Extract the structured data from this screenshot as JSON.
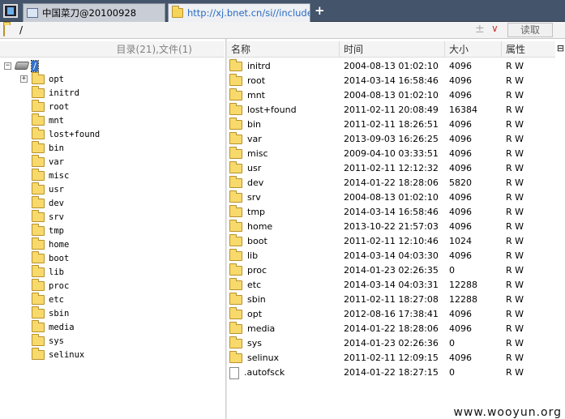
{
  "tabs": [
    {
      "label": "中国菜刀@20100928",
      "active": false,
      "icon": "page-icon"
    },
    {
      "label": "http://xj.bnet.cn/si//include/...",
      "active": true,
      "icon": "folder-icon"
    }
  ],
  "tab_add": "+",
  "address": {
    "path": "/",
    "separator": "±",
    "dropdown": "∨",
    "read_button": "读取"
  },
  "left_header": "目录(21),文件(1)",
  "tree": {
    "root": {
      "expand": "−",
      "label": "/"
    },
    "items": [
      {
        "label": "opt",
        "expand": "+"
      },
      {
        "label": "initrd"
      },
      {
        "label": "root"
      },
      {
        "label": "mnt"
      },
      {
        "label": "lost+found"
      },
      {
        "label": "bin"
      },
      {
        "label": "var"
      },
      {
        "label": "misc"
      },
      {
        "label": "usr"
      },
      {
        "label": "dev"
      },
      {
        "label": "srv"
      },
      {
        "label": "tmp"
      },
      {
        "label": "home"
      },
      {
        "label": "boot"
      },
      {
        "label": "lib"
      },
      {
        "label": "proc"
      },
      {
        "label": "etc"
      },
      {
        "label": "sbin"
      },
      {
        "label": "media"
      },
      {
        "label": "sys"
      },
      {
        "label": "selinux"
      }
    ]
  },
  "columns": {
    "name": "名称",
    "time": "时间",
    "size": "大小",
    "perm": "属性"
  },
  "scroll_glyph": "⊟",
  "files": [
    {
      "name": "initrd",
      "time": "2004-08-13 01:02:10",
      "size": "4096",
      "perm": "R W",
      "type": "dir"
    },
    {
      "name": "root",
      "time": "2014-03-14 16:58:46",
      "size": "4096",
      "perm": "R W",
      "type": "dir"
    },
    {
      "name": "mnt",
      "time": "2004-08-13 01:02:10",
      "size": "4096",
      "perm": "R W",
      "type": "dir"
    },
    {
      "name": "lost+found",
      "time": "2011-02-11 20:08:49",
      "size": "16384",
      "perm": "R W",
      "type": "dir"
    },
    {
      "name": "bin",
      "time": "2011-02-11 18:26:51",
      "size": "4096",
      "perm": "R W",
      "type": "dir"
    },
    {
      "name": "var",
      "time": "2013-09-03 16:26:25",
      "size": "4096",
      "perm": "R W",
      "type": "dir"
    },
    {
      "name": "misc",
      "time": "2009-04-10 03:33:51",
      "size": "4096",
      "perm": "R W",
      "type": "dir"
    },
    {
      "name": "usr",
      "time": "2011-02-11 12:12:32",
      "size": "4096",
      "perm": "R W",
      "type": "dir"
    },
    {
      "name": "dev",
      "time": "2014-01-22 18:28:06",
      "size": "5820",
      "perm": "R W",
      "type": "dir"
    },
    {
      "name": "srv",
      "time": "2004-08-13 01:02:10",
      "size": "4096",
      "perm": "R W",
      "type": "dir"
    },
    {
      "name": "tmp",
      "time": "2014-03-14 16:58:46",
      "size": "4096",
      "perm": "R W",
      "type": "dir"
    },
    {
      "name": "home",
      "time": "2013-10-22 21:57:03",
      "size": "4096",
      "perm": "R W",
      "type": "dir"
    },
    {
      "name": "boot",
      "time": "2011-02-11 12:10:46",
      "size": "1024",
      "perm": "R W",
      "type": "dir"
    },
    {
      "name": "lib",
      "time": "2014-03-14 04:03:30",
      "size": "4096",
      "perm": "R W",
      "type": "dir"
    },
    {
      "name": "proc",
      "time": "2014-01-23 02:26:35",
      "size": "0",
      "perm": "R W",
      "type": "dir"
    },
    {
      "name": "etc",
      "time": "2014-03-14 04:03:31",
      "size": "12288",
      "perm": "R W",
      "type": "dir"
    },
    {
      "name": "sbin",
      "time": "2011-02-11 18:27:08",
      "size": "12288",
      "perm": "R W",
      "type": "dir"
    },
    {
      "name": "opt",
      "time": "2012-08-16 17:38:41",
      "size": "4096",
      "perm": "R W",
      "type": "dir"
    },
    {
      "name": "media",
      "time": "2014-01-22 18:28:06",
      "size": "4096",
      "perm": "R W",
      "type": "dir"
    },
    {
      "name": "sys",
      "time": "2014-01-23 02:26:36",
      "size": "0",
      "perm": "R W",
      "type": "dir"
    },
    {
      "name": "selinux",
      "time": "2011-02-11 12:09:15",
      "size": "4096",
      "perm": "R W",
      "type": "dir"
    },
    {
      "name": ".autofsck",
      "time": "2014-01-22 18:27:15",
      "size": "0",
      "perm": "R W",
      "type": "file"
    }
  ],
  "watermark": "www.wooyun.org"
}
